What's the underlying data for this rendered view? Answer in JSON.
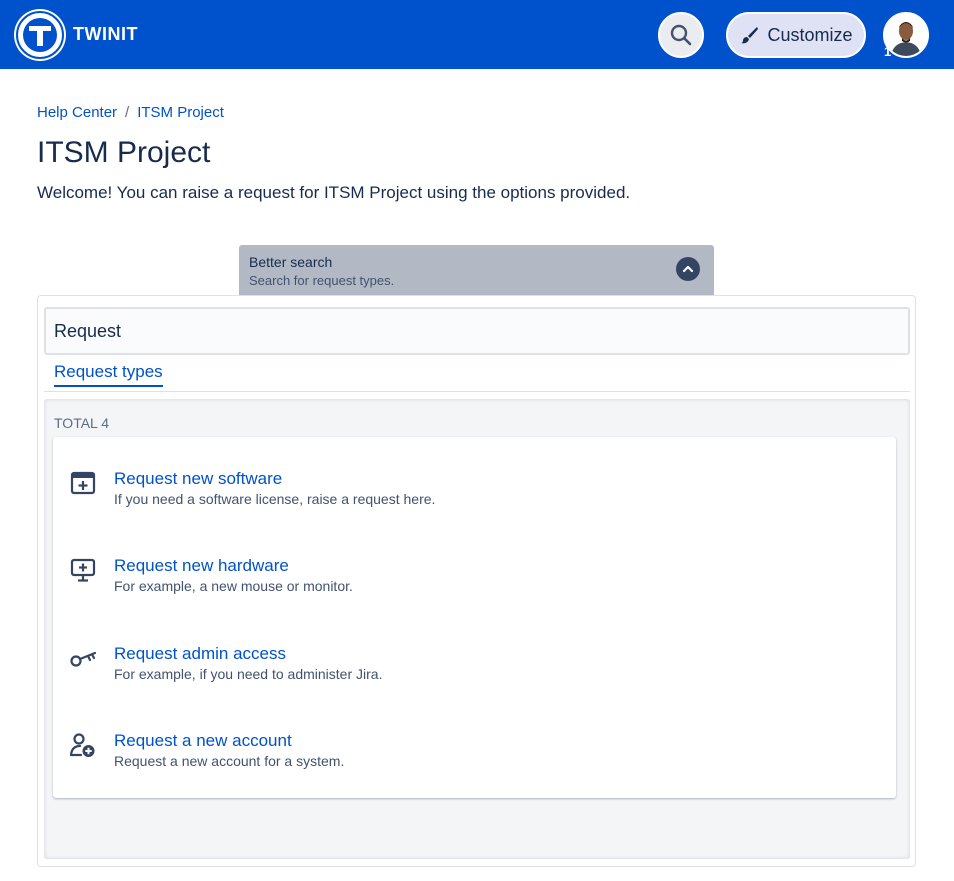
{
  "header": {
    "brand": "TWINIT",
    "customize_label": "Customize",
    "avatar_count": "1"
  },
  "breadcrumb": {
    "items": [
      "Help Center",
      "ITSM Project"
    ],
    "separator": "/"
  },
  "page": {
    "title": "ITSM Project",
    "description": "Welcome! You can raise a request for ITSM Project using the options provided."
  },
  "better_search": {
    "title": "Better search",
    "subtitle": "Search for request types."
  },
  "search": {
    "value": "Request"
  },
  "tabs": {
    "request_types": "Request types"
  },
  "results": {
    "total_label": "TOTAL 4",
    "items": [
      {
        "name": "Request new software",
        "description": "If you need a software license, raise a request here.",
        "icon": "software-window-icon"
      },
      {
        "name": "Request new hardware",
        "description": "For example, a new mouse or monitor.",
        "icon": "monitor-plus-icon"
      },
      {
        "name": "Request admin access",
        "description": "For example, if you need to administer Jira.",
        "icon": "key-icon"
      },
      {
        "name": "Request a new account",
        "description": "Request a new account for a system.",
        "icon": "add-user-icon"
      }
    ]
  },
  "colors": {
    "header_bg": "#0052cc",
    "link": "#0052cc",
    "text": "#172b4d"
  }
}
